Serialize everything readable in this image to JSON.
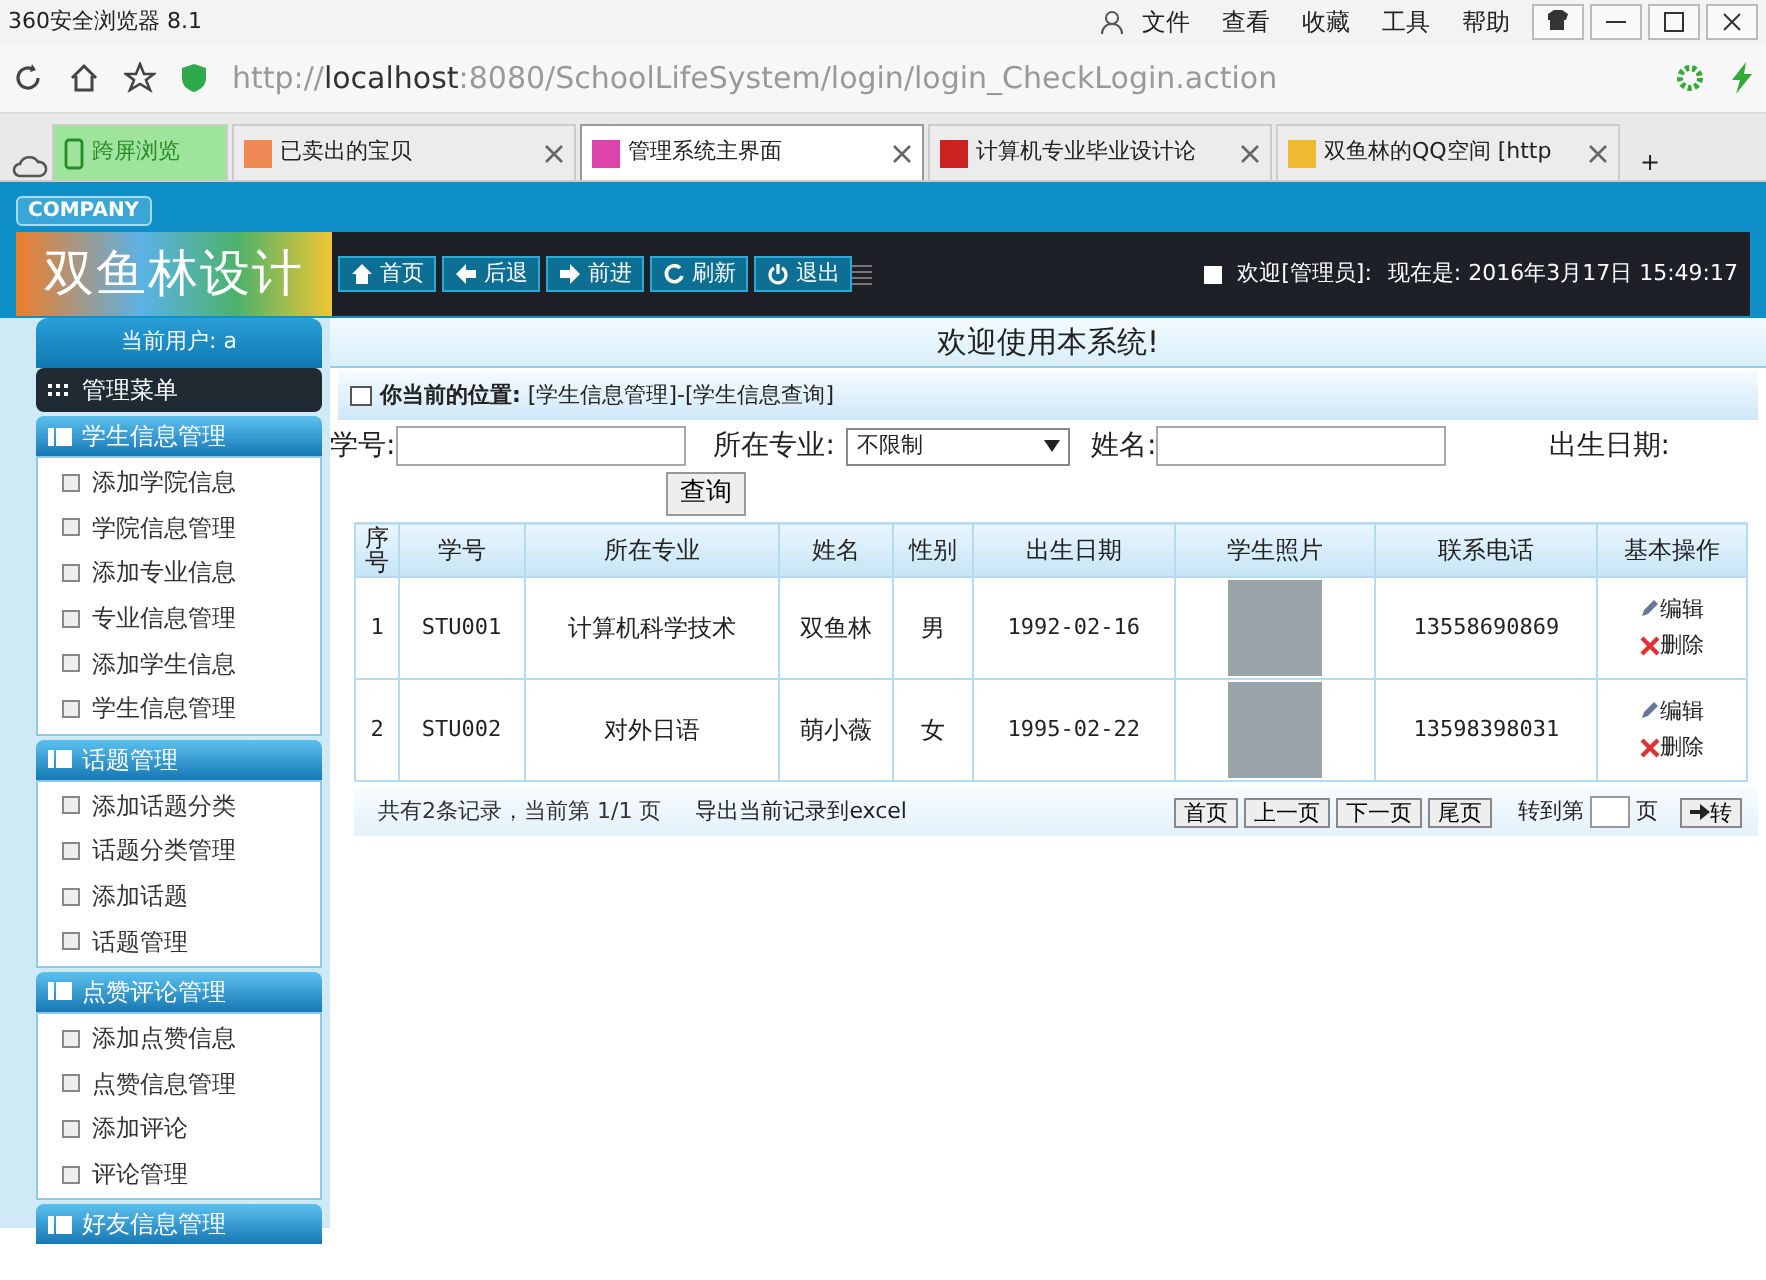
{
  "browser": {
    "title": "360安全浏览器 8.1",
    "menu": [
      "文件",
      "查看",
      "收藏",
      "工具",
      "帮助"
    ],
    "url": "http://**localhost**:8080/SchoolLifeSystem/login/login_CheckLogin.action",
    "tabs": [
      {
        "label": "跨屏浏览",
        "kind": "pinned",
        "selected": false
      },
      {
        "label": "已卖出的宝贝",
        "kind": "page",
        "selected": false
      },
      {
        "label": "管理系统主界面",
        "kind": "page",
        "selected": true
      },
      {
        "label": "计算机专业毕业设计论",
        "kind": "page",
        "selected": false
      },
      {
        "label": "双鱼林的QQ空间 [http",
        "kind": "page",
        "selected": false
      }
    ],
    "new_tab": "+"
  },
  "header": {
    "company": "COMPANY",
    "logo": "双鱼林设计",
    "nav": [
      "首页",
      "后退",
      "前进",
      "刷新",
      "退出"
    ],
    "welcome": "欢迎[管理员]:",
    "time": "现在是: 2016年3月17日 15:49:17"
  },
  "sidebar": {
    "current_user": "当前用户: a",
    "menu_title": "管理菜单",
    "sections": [
      {
        "title": "学生信息管理",
        "items": [
          "添加学院信息",
          "学院信息管理",
          "添加专业信息",
          "专业信息管理",
          "添加学生信息",
          "学生信息管理"
        ]
      },
      {
        "title": "话题管理",
        "items": [
          "添加话题分类",
          "话题分类管理",
          "添加话题",
          "话题管理"
        ]
      },
      {
        "title": "点赞评论管理",
        "items": [
          "添加点赞信息",
          "点赞信息管理",
          "添加评论",
          "评论管理"
        ]
      },
      {
        "title": "好友信息管理"
      }
    ]
  },
  "main": {
    "welcome": "欢迎使用本系统!",
    "breadcrumb": "**你当前的位置:** [学生信息管理]-[学生信息查询]",
    "filters": {
      "student_id_label": "学号:",
      "major_label": "所在专业:",
      "major_value": "不限制",
      "name_label": "姓名:",
      "birthday_label": "出生日期:",
      "query_button": "查询"
    },
    "table": {
      "columns": [
        "序号",
        "学号",
        "所在专业",
        "姓名",
        "性别",
        "出生日期",
        "学生照片",
        "联系电话",
        "基本操作"
      ],
      "rows": [
        {
          "cells": [
            "1",
            "STU001",
            "计算机科学技术",
            "双鱼林",
            "男",
            "1992-02-16"
          ],
          "phone": "13558690869",
          "edit": "编辑",
          "delete": "删除"
        },
        {
          "cells": [
            "2",
            "STU002",
            "对外日语",
            "萌小薇",
            "女",
            "1995-02-22"
          ],
          "phone": "13598398031",
          "edit": "编辑",
          "delete": "删除"
        }
      ]
    },
    "pager": {
      "summary": "共有2条记录，当前第 1/1 页",
      "export": "导出当前记录到excel",
      "buttons": [
        "首页",
        "上一页",
        "下一页",
        "尾页"
      ],
      "goto_label": "转到第",
      "page_label": "页",
      "go_button": "转"
    }
  }
}
